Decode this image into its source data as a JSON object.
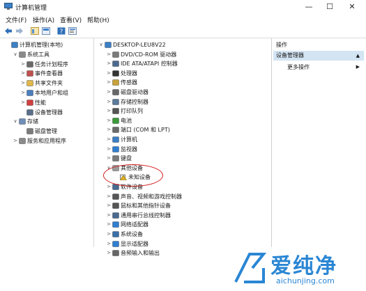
{
  "window": {
    "title": "计算机管理",
    "minimize": "—",
    "maximize": "☐",
    "close": "✕"
  },
  "menu": [
    "文件(F)",
    "操作(A)",
    "查看(V)",
    "帮助(H)"
  ],
  "left_tree": [
    {
      "label": "计算机管理(本地)",
      "chev": "",
      "icon": "computer-management-icon",
      "indent": 0
    },
    {
      "label": "系统工具",
      "chev": "∨",
      "icon": "system-tools-icon",
      "indent": 1
    },
    {
      "label": "任务计划程序",
      "chev": ">",
      "icon": "task-scheduler-icon",
      "indent": 2
    },
    {
      "label": "事件查看器",
      "chev": ">",
      "icon": "event-viewer-icon",
      "indent": 2
    },
    {
      "label": "共享文件夹",
      "chev": ">",
      "icon": "shared-folders-icon",
      "indent": 2
    },
    {
      "label": "本地用户和组",
      "chev": ">",
      "icon": "users-groups-icon",
      "indent": 2
    },
    {
      "label": "性能",
      "chev": ">",
      "icon": "performance-icon",
      "indent": 2
    },
    {
      "label": "设备管理器",
      "chev": "",
      "icon": "device-manager-icon",
      "indent": 2
    },
    {
      "label": "存储",
      "chev": "∨",
      "icon": "storage-icon",
      "indent": 1
    },
    {
      "label": "磁盘管理",
      "chev": "",
      "icon": "disk-management-icon",
      "indent": 2
    },
    {
      "label": "服务和应用程序",
      "chev": ">",
      "icon": "services-apps-icon",
      "indent": 1
    }
  ],
  "device_tree": [
    {
      "label": "DESKTOP-LEU8V22",
      "chev": "∨",
      "icon": "computer-icon",
      "indent": 0
    },
    {
      "label": "DVD/CD-ROM 驱动器",
      "chev": ">",
      "icon": "dvd-drive-icon",
      "indent": 1
    },
    {
      "label": "IDE ATA/ATAPI 控制器",
      "chev": ">",
      "icon": "ide-controller-icon",
      "indent": 1
    },
    {
      "label": "处理器",
      "chev": ">",
      "icon": "processor-icon",
      "indent": 1
    },
    {
      "label": "传感器",
      "chev": ">",
      "icon": "sensor-icon",
      "indent": 1
    },
    {
      "label": "磁盘驱动器",
      "chev": ">",
      "icon": "disk-drive-icon",
      "indent": 1
    },
    {
      "label": "存储控制器",
      "chev": ">",
      "icon": "storage-controller-icon",
      "indent": 1
    },
    {
      "label": "打印队列",
      "chev": ">",
      "icon": "print-queue-icon",
      "indent": 1
    },
    {
      "label": "电池",
      "chev": ">",
      "icon": "battery-icon",
      "indent": 1
    },
    {
      "label": "端口 (COM 和 LPT)",
      "chev": ">",
      "icon": "port-icon",
      "indent": 1
    },
    {
      "label": "计算机",
      "chev": ">",
      "icon": "computer-icon",
      "indent": 1
    },
    {
      "label": "监视器",
      "chev": ">",
      "icon": "monitor-icon",
      "indent": 1
    },
    {
      "label": "键盘",
      "chev": ">",
      "icon": "keyboard-icon",
      "indent": 1
    },
    {
      "label": "其他设备",
      "chev": "∨",
      "icon": "other-devices-icon",
      "indent": 1
    },
    {
      "label": "未知设备",
      "chev": "",
      "icon": "unknown-device-warning-icon",
      "indent": 2
    },
    {
      "label": "软件设备",
      "chev": ">",
      "icon": "software-device-icon",
      "indent": 1
    },
    {
      "label": "声音、视频和游戏控制器",
      "chev": ">",
      "icon": "sound-controller-icon",
      "indent": 1
    },
    {
      "label": "鼠标和其他指针设备",
      "chev": ">",
      "icon": "mouse-icon",
      "indent": 1
    },
    {
      "label": "通用串行总线控制器",
      "chev": ">",
      "icon": "usb-controller-icon",
      "indent": 1
    },
    {
      "label": "网络适配器",
      "chev": ">",
      "icon": "network-adapter-icon",
      "indent": 1
    },
    {
      "label": "系统设备",
      "chev": ">",
      "icon": "system-device-icon",
      "indent": 1
    },
    {
      "label": "显示适配器",
      "chev": ">",
      "icon": "display-adapter-icon",
      "indent": 1
    },
    {
      "label": "音频输入和输出",
      "chev": ">",
      "icon": "audio-io-icon",
      "indent": 1
    }
  ],
  "actions": {
    "header": "操作",
    "selected": "设备管理器",
    "more": "更多操作"
  },
  "watermark": {
    "text": "爱纯净",
    "url": "aichunjing.com"
  },
  "colors": {
    "accent": "#2a86d4",
    "selected_bg": "#d3e4f3",
    "highlight_circle": "#d21b1b"
  }
}
